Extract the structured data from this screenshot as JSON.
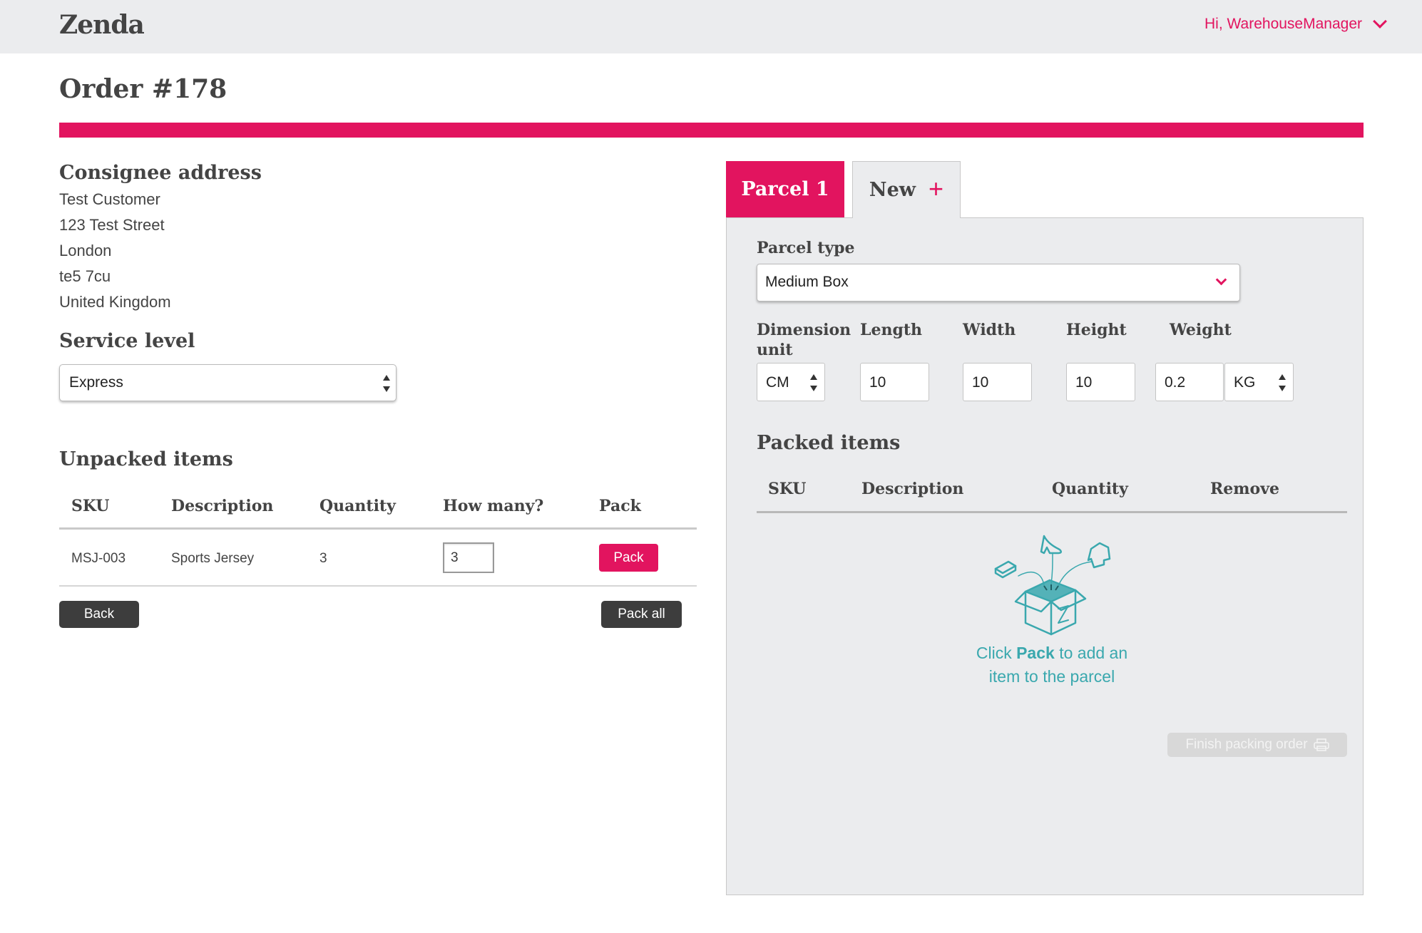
{
  "header": {
    "logo": "Zenda",
    "greeting": "Hi, WarehouseManager",
    "user_menu_icon": "chevron-down-icon"
  },
  "page": {
    "title": "Order #178"
  },
  "consignee": {
    "heading": "Consignee address",
    "lines": [
      "Test Customer",
      "123 Test Street",
      "London",
      "te5 7cu",
      "United Kingdom"
    ]
  },
  "service": {
    "heading": "Service level",
    "selected": "Express"
  },
  "unpacked": {
    "heading": "Unpacked items",
    "columns": [
      "SKU",
      "Description",
      "Quantity",
      "How many?",
      "Pack"
    ],
    "rows": [
      {
        "sku": "MSJ-003",
        "description": "Sports Jersey",
        "quantity": "3",
        "how_many": "3",
        "pack_label": "Pack"
      }
    ],
    "back_label": "Back",
    "pack_all_label": "Pack all"
  },
  "parcels": {
    "tabs": [
      {
        "label": "Parcel 1",
        "active": true
      },
      {
        "label": "New",
        "active": false,
        "icon": "plus-icon"
      }
    ],
    "parcel_type_label": "Parcel type",
    "parcel_type_selected": "Medium Box",
    "dimension_unit_label_1": "Dimension",
    "dimension_unit_label_2": "unit",
    "length_label": "Length",
    "width_label": "Width",
    "height_label": "Height",
    "weight_label": "Weight",
    "dimension_unit": "CM",
    "length": "10",
    "width": "10",
    "height": "10",
    "weight": "0.2",
    "weight_unit": "KG"
  },
  "packed": {
    "heading": "Packed items",
    "columns": [
      "SKU",
      "Description",
      "Quantity",
      "Remove"
    ],
    "empty_prefix": "Click ",
    "empty_bold": "Pack",
    "empty_suffix_1": " to add an",
    "empty_suffix_2": "item to the parcel",
    "empty_icon": "empty-parcel-illustration",
    "finish_label": "Finish packing order",
    "finish_icon": "printer-icon"
  },
  "colors": {
    "accent": "#e2145f",
    "teal": "#3aa8ae",
    "header_bg": "#ebecee",
    "dark_button": "#3d3d3d"
  }
}
